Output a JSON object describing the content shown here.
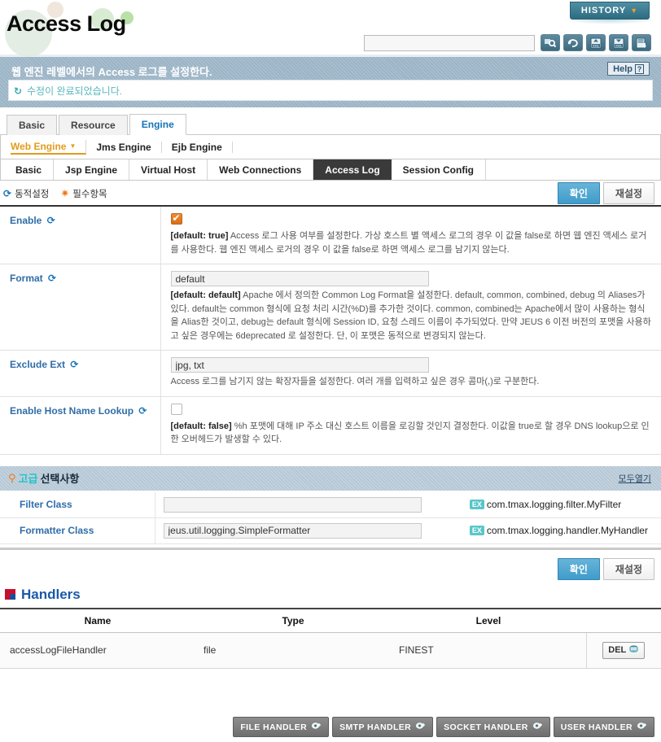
{
  "header": {
    "title": "Access Log",
    "history_button": "HISTORY",
    "history_caret_icon": "chevron-down-icon",
    "search_placeholder": "",
    "search_value": "",
    "toolbar_icons": [
      {
        "name": "search-icon",
        "label": "Search"
      },
      {
        "name": "refresh-icon",
        "label": "Refresh"
      },
      {
        "name": "xml-import-icon",
        "label": "XML Import"
      },
      {
        "name": "xml-export-icon",
        "label": "XML Export"
      },
      {
        "name": "save-export-icon",
        "label": "Export"
      }
    ]
  },
  "info": {
    "title": "웹 엔진 레벨에서의 Access 로그를 설정한다.",
    "help_label": "Help",
    "help_mark": "?",
    "message_icon": "refresh-icon",
    "message": "수정이 완료되었습니다."
  },
  "tabs_primary": [
    {
      "label": "Basic",
      "active": false
    },
    {
      "label": "Resource",
      "active": false
    },
    {
      "label": "Engine",
      "active": true
    }
  ],
  "tabs_secondary": [
    {
      "label": "Web Engine",
      "active": true,
      "caret": "▼"
    },
    {
      "label": "Jms Engine",
      "active": false,
      "caret": ""
    },
    {
      "label": "Ejb Engine",
      "active": false,
      "caret": ""
    }
  ],
  "tabs_tertiary": [
    {
      "label": "Basic",
      "active": false
    },
    {
      "label": "Jsp Engine",
      "active": false
    },
    {
      "label": "Virtual Host",
      "active": false
    },
    {
      "label": "Web Connections",
      "active": false
    },
    {
      "label": "Access Log",
      "active": true
    },
    {
      "label": "Session Config",
      "active": false
    }
  ],
  "legend": {
    "dynamic_icon": "sync-icon",
    "dynamic_label": "동적설정",
    "required_icon": "asterisk-icon",
    "required_label": "필수항목"
  },
  "buttons": {
    "ok": "확인",
    "reset": "재설정"
  },
  "form_rows": [
    {
      "label": "Enable",
      "dynamic": true,
      "control": "checkbox",
      "checked": true,
      "value": "",
      "desc_prefix": "[default: true]",
      "desc": "Access 로그 사용 여부를 설정한다. 가상 호스트 별 액세스 로그의 경우 이 값을 false로 하면 웹 엔진 액세스 로거를 사용한다. 웹 엔진 액세스 로거의 경우 이 값을 false로 하면 액세스 로그를 남기지 않는다."
    },
    {
      "label": "Format",
      "dynamic": true,
      "control": "text",
      "checked": false,
      "value": "default",
      "desc_prefix": "[default: default]",
      "desc": "Apache 에서 정의한 Common Log Format을 설정한다. default, common, combined, debug 의 Aliases가 있다. default는 common 형식에 요청 처리 시간(%D)를 추가한 것이다. common, combined는 Apache에서 많이 사용하는 형식을 Alias한 것이고, debug는 default 형식에 Session ID, 요청 스레드 이름이 추가되었다. 만약 JEUS 6 이전 버전의 포맷을 사용하고 싶은 경우에는 6deprecated 로 설정한다. 단, 이 포맷은 동적으로 변경되지 않는다."
    },
    {
      "label": "Exclude Ext",
      "dynamic": true,
      "control": "text",
      "checked": false,
      "value": "jpg, txt",
      "desc_prefix": "",
      "desc": "Access 로그를 남기지 않는 확장자들을 설정한다. 여러 개를 입력하고 싶은 경우 콤마(,)로 구분한다."
    },
    {
      "label": "Enable Host Name Lookup",
      "dynamic": true,
      "control": "checkbox",
      "checked": false,
      "value": "",
      "desc_prefix": "[default: false]",
      "desc": "%h 포맷에 대해 IP 주소 대신 호스트 이름을 로깅할 것인지 결정한다. 이값을 true로 할 경우 DNS lookup으로 인한 오버헤드가 발생할 수 있다."
    }
  ],
  "advanced": {
    "pin_icon": "pin-icon",
    "title_accent": "고급",
    "title_rest": "선택사항",
    "expand_all": "모두열기",
    "rows": [
      {
        "label": "Filter Class",
        "value": "",
        "placeholder": "",
        "ex_tag": "EX",
        "ex_text": "com.tmax.logging.filter.MyFilter"
      },
      {
        "label": "Formatter Class",
        "value": "jeus.util.logging.SimpleFormatter",
        "placeholder": "",
        "ex_tag": "EX",
        "ex_text": "com.tmax.logging.handler.MyHandler"
      }
    ]
  },
  "handlers": {
    "icon": "square-badge-icon",
    "title": "Handlers",
    "columns": [
      "Name",
      "Type",
      "Level",
      ""
    ],
    "rows": [
      {
        "name": "accessLogFileHandler",
        "type": "file",
        "level": "FINEST",
        "delete_label": "DEL",
        "delete_icon": "trash-icon"
      }
    ]
  },
  "bottom_buttons": [
    {
      "label": "FILE HANDLER",
      "icon": "add-icon"
    },
    {
      "label": "SMTP HANDLER",
      "icon": "add-icon"
    },
    {
      "label": "SOCKET HANDLER",
      "icon": "add-icon"
    },
    {
      "label": "USER HANDLER",
      "icon": "add-icon"
    }
  ]
}
